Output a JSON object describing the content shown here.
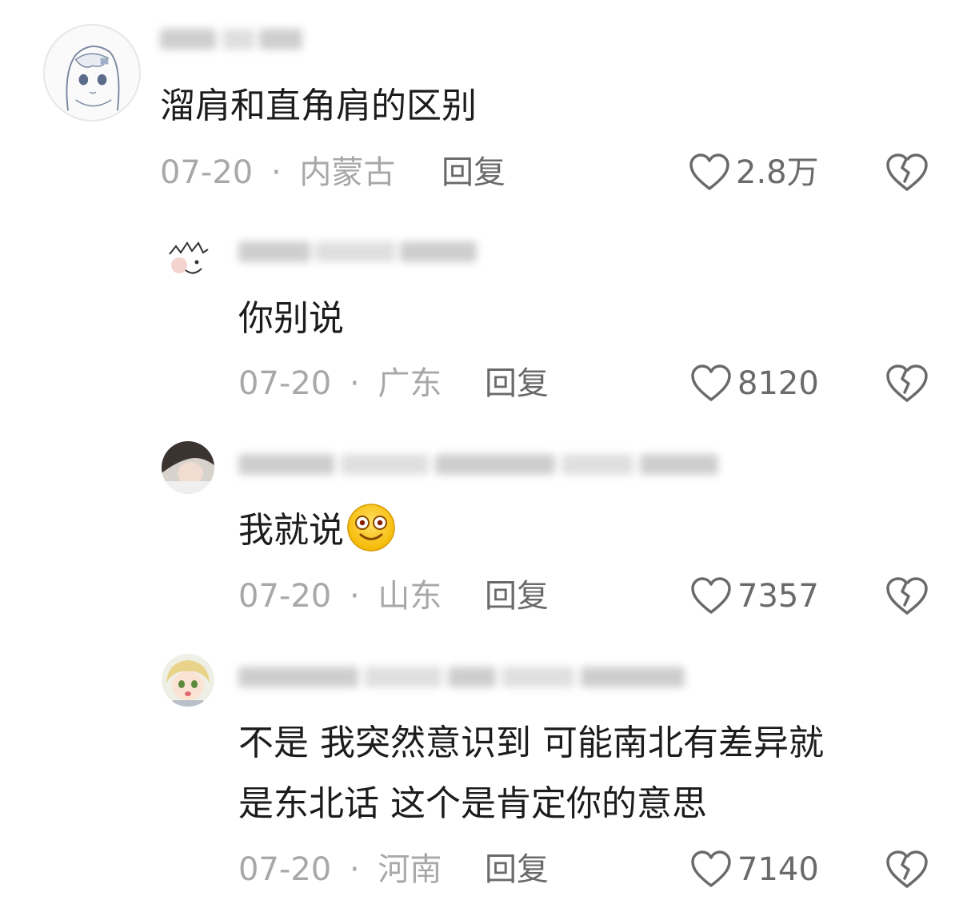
{
  "comments": [
    {
      "text": "溜肩和直角肩的区别",
      "date": "07-20",
      "separator": "·",
      "location": "内蒙古",
      "reply_label": "回复",
      "likes": "2.8万",
      "avatar_icon": "anime-girl-avatar"
    },
    {
      "text": "你别说",
      "date": "07-20",
      "separator": "·",
      "location": "广东",
      "reply_label": "回复",
      "likes": "8120",
      "avatar_icon": "cartoon-face-avatar"
    },
    {
      "text": "我就说",
      "emoji": "smiling-face-emoji",
      "date": "07-20",
      "separator": "·",
      "location": "山东",
      "reply_label": "回复",
      "likes": "7357",
      "avatar_icon": "photo-avatar"
    },
    {
      "text_line1": "不是 我突然意识到 可能南北有差异就",
      "text_line2": "是东北话 这个是肯定你的意思",
      "date": "07-20",
      "separator": "·",
      "location": "河南",
      "reply_label": "回复",
      "likes": "7140",
      "avatar_icon": "anime-character-avatar"
    }
  ],
  "colors": {
    "text": "#1c1c1c",
    "meta": "#a8a8a8",
    "action": "#6a6a6a",
    "background": "#ffffff"
  }
}
